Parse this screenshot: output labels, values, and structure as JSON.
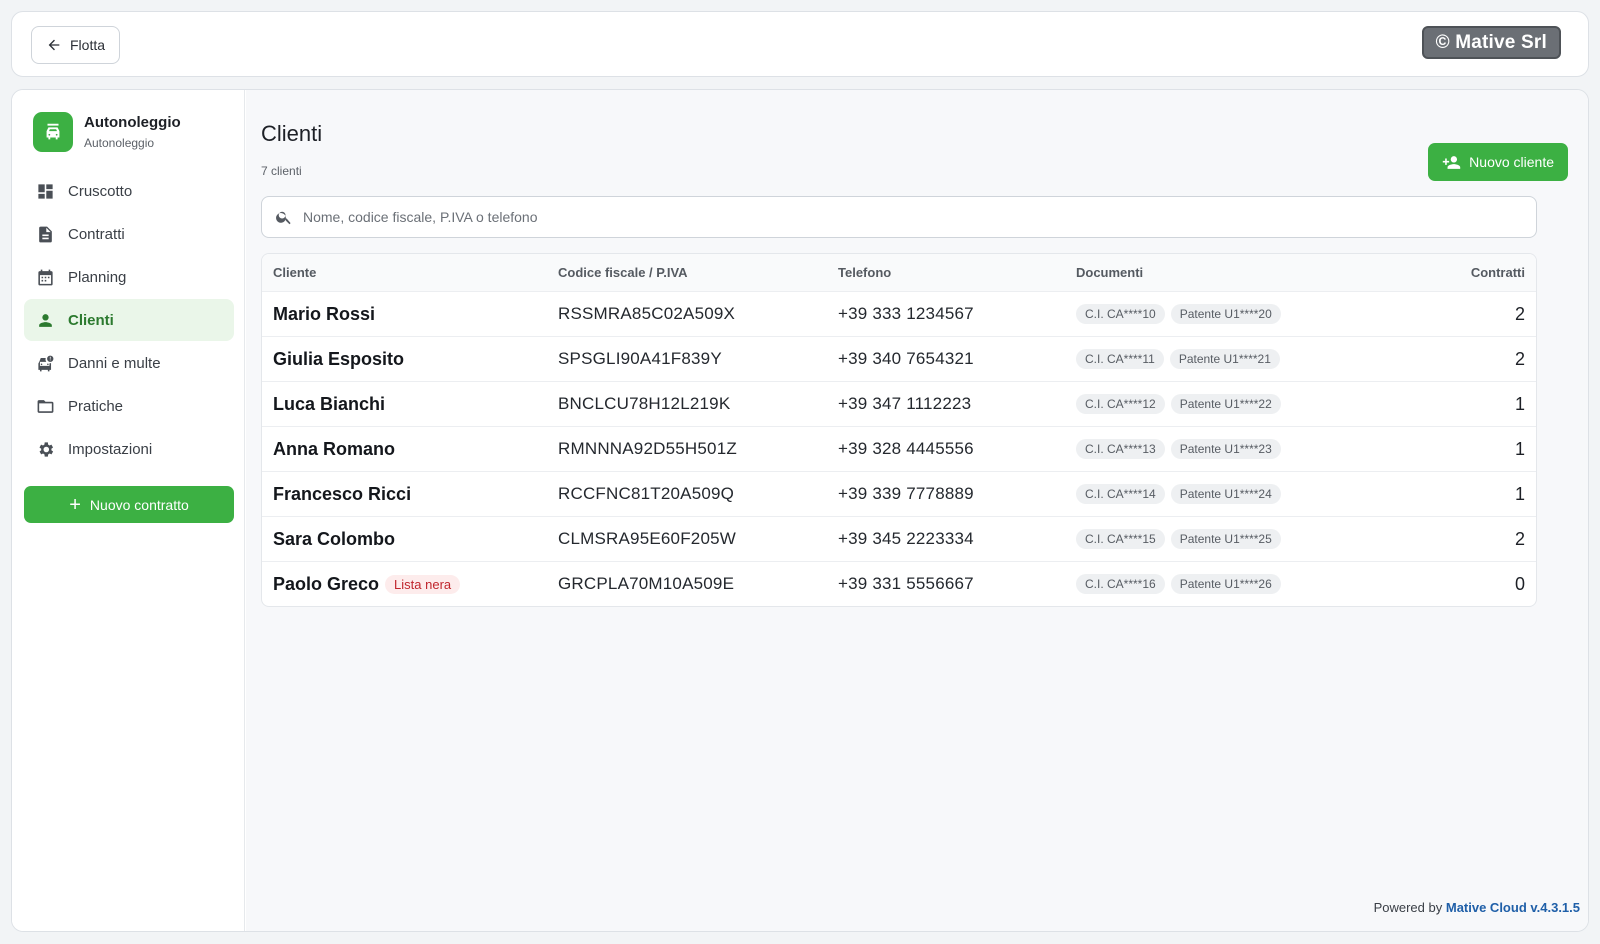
{
  "topbar": {
    "back_label": "Flotta",
    "copyright": "© Mative Srl"
  },
  "brand": {
    "title": "Autonoleggio",
    "subtitle": "Autonoleggio"
  },
  "nav": {
    "items": [
      {
        "label": "Cruscotto",
        "icon": "dashboard-icon"
      },
      {
        "label": "Contratti",
        "icon": "document-icon"
      },
      {
        "label": "Planning",
        "icon": "calendar-icon"
      },
      {
        "label": "Clienti",
        "icon": "person-icon",
        "active": true
      },
      {
        "label": "Danni e multe",
        "icon": "car-damage-icon"
      },
      {
        "label": "Pratiche",
        "icon": "folder-icon"
      },
      {
        "label": "Impostazioni",
        "icon": "gear-icon"
      }
    ],
    "new_contract_label": "Nuovo contratto"
  },
  "page": {
    "title": "Clienti",
    "count": "7 clienti",
    "new_client_label": "Nuovo cliente",
    "search_placeholder": "Nome, codice fiscale, P.IVA o telefono"
  },
  "table": {
    "columns": [
      "Cliente",
      "Codice fiscale / P.IVA",
      "Telefono",
      "Documenti",
      "Contratti"
    ],
    "rows": [
      {
        "name": "Mario Rossi",
        "cf": "RSSMRA85C02A509X",
        "tel": "+39 333 1234567",
        "doc1": "C.I. CA****10",
        "doc2": "Patente U1****20",
        "contracts": "2"
      },
      {
        "name": "Giulia Esposito",
        "cf": "SPSGLI90A41F839Y",
        "tel": "+39 340 7654321",
        "doc1": "C.I. CA****11",
        "doc2": "Patente U1****21",
        "contracts": "2"
      },
      {
        "name": "Luca Bianchi",
        "cf": "BNCLCU78H12L219K",
        "tel": "+39 347 1112223",
        "doc1": "C.I. CA****12",
        "doc2": "Patente U1****22",
        "contracts": "1"
      },
      {
        "name": "Anna Romano",
        "cf": "RMNNNA92D55H501Z",
        "tel": "+39 328 4445556",
        "doc1": "C.I. CA****13",
        "doc2": "Patente U1****23",
        "contracts": "1"
      },
      {
        "name": "Francesco Ricci",
        "cf": "RCCFNC81T20A509Q",
        "tel": "+39 339 7778889",
        "doc1": "C.I. CA****14",
        "doc2": "Patente U1****24",
        "contracts": "1"
      },
      {
        "name": "Sara Colombo",
        "cf": "CLMSRA95E60F205W",
        "tel": "+39 345 2223334",
        "doc1": "C.I. CA****15",
        "doc2": "Patente U1****25",
        "contracts": "2"
      },
      {
        "name": "Paolo Greco",
        "badge": "Lista nera",
        "cf": "GRCPLA70M10A509E",
        "tel": "+39 331 5556667",
        "doc1": "C.I. CA****16",
        "doc2": "Patente U1****26",
        "contracts": "0"
      }
    ]
  },
  "footer": {
    "prefix": "Powered by",
    "brand": "Mative Cloud v.4.3.1.5"
  },
  "colors": {
    "accent": "#3cb043",
    "active_nav_bg": "#eaf6e9",
    "blacklist": "#c0262d",
    "footer_link": "#1f5fa8"
  }
}
